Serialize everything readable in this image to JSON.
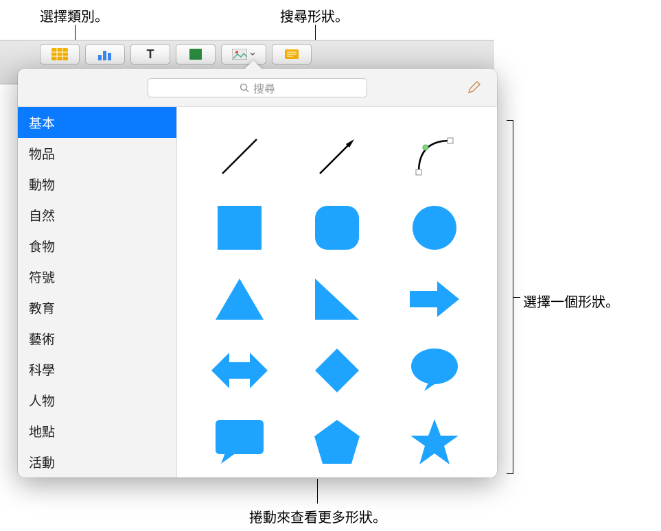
{
  "callouts": {
    "chooseCategory": "選擇類別。",
    "searchShape": "搜尋形狀。",
    "chooseShape": "選擇一個形狀。",
    "scrollMore": "捲動來查看更多形狀。"
  },
  "toolbar": {
    "buttons": [
      {
        "label": "表格",
        "icon": "table",
        "color": "#f5b301"
      },
      {
        "label": "圖表",
        "icon": "chart",
        "color": "#3b88f5"
      },
      {
        "label": "文字",
        "icon": "text",
        "color": "#333333"
      },
      {
        "label": "形狀",
        "icon": "shape",
        "color": "#2a8a3f"
      },
      {
        "label": "媒體",
        "icon": "media",
        "color": "#d94c4c"
      },
      {
        "label": "註解",
        "icon": "comment",
        "color": "#f5b301"
      }
    ]
  },
  "search": {
    "placeholder": "搜尋"
  },
  "sidebar": {
    "items": [
      {
        "label": "基本",
        "selected": true
      },
      {
        "label": "物品",
        "selected": false
      },
      {
        "label": "動物",
        "selected": false
      },
      {
        "label": "自然",
        "selected": false
      },
      {
        "label": "食物",
        "selected": false
      },
      {
        "label": "符號",
        "selected": false
      },
      {
        "label": "教育",
        "selected": false
      },
      {
        "label": "藝術",
        "selected": false
      },
      {
        "label": "科學",
        "selected": false
      },
      {
        "label": "人物",
        "selected": false
      },
      {
        "label": "地點",
        "selected": false
      },
      {
        "label": "活動",
        "selected": false
      }
    ]
  },
  "shapes": [
    {
      "name": "line"
    },
    {
      "name": "arrow-line"
    },
    {
      "name": "curve"
    },
    {
      "name": "square"
    },
    {
      "name": "rounded-square"
    },
    {
      "name": "circle"
    },
    {
      "name": "triangle"
    },
    {
      "name": "right-triangle"
    },
    {
      "name": "arrow-right"
    },
    {
      "name": "arrow-double"
    },
    {
      "name": "diamond"
    },
    {
      "name": "speech-bubble"
    },
    {
      "name": "callout-rect"
    },
    {
      "name": "pentagon"
    },
    {
      "name": "star"
    }
  ],
  "colors": {
    "accent": "#0a7aff",
    "shapeFill": "#1ea4ff"
  }
}
